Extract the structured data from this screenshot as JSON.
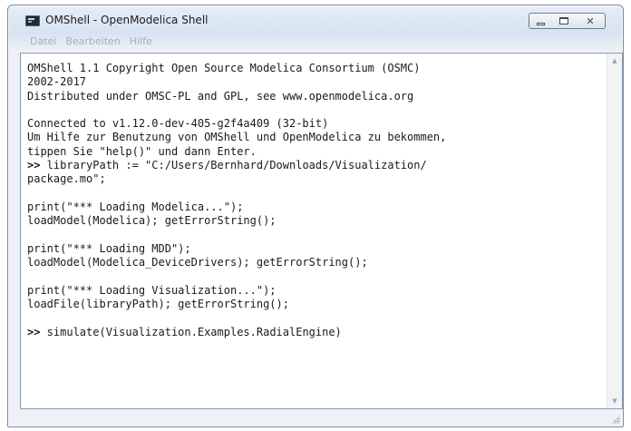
{
  "window": {
    "title": "OMShell - OpenModelica Shell",
    "controls": {
      "minimize_icon": "minimize-icon",
      "maximize_icon": "maximize-icon",
      "close_icon": "close-icon",
      "close_glyph": "✕"
    }
  },
  "menubar": {
    "items": [
      "Datei",
      "Bearbeiten",
      "Hilfe"
    ]
  },
  "console": {
    "lines": [
      {
        "prompt": "",
        "text": "OMShell 1.1 Copyright Open Source Modelica Consortium (OSMC)"
      },
      {
        "prompt": "",
        "text": "2002-2017"
      },
      {
        "prompt": "",
        "text": "Distributed under OMSC-PL and GPL, see www.openmodelica.org"
      },
      {
        "prompt": "",
        "text": ""
      },
      {
        "prompt": "",
        "text": "Connected to v1.12.0-dev-405-g2f4a409 (32-bit)"
      },
      {
        "prompt": "",
        "text": "Um Hilfe zur Benutzung von OMShell und OpenModelica zu bekommen,"
      },
      {
        "prompt": "",
        "text": "tippen Sie \"help()\" und dann Enter."
      },
      {
        "prompt": ">>",
        "text": " libraryPath := \"C:/Users/Bernhard/Downloads/Visualization/"
      },
      {
        "prompt": "",
        "text": "package.mo\";"
      },
      {
        "prompt": "",
        "text": ""
      },
      {
        "prompt": "",
        "text": "print(\"*** Loading Modelica...\");"
      },
      {
        "prompt": "",
        "text": "loadModel(Modelica); getErrorString();"
      },
      {
        "prompt": "",
        "text": ""
      },
      {
        "prompt": "",
        "text": "print(\"*** Loading MDD\");"
      },
      {
        "prompt": "",
        "text": "loadModel(Modelica_DeviceDrivers); getErrorString();"
      },
      {
        "prompt": "",
        "text": ""
      },
      {
        "prompt": "",
        "text": "print(\"*** Loading Visualization...\");"
      },
      {
        "prompt": "",
        "text": "loadFile(libraryPath); getErrorString();"
      },
      {
        "prompt": "",
        "text": ""
      },
      {
        "prompt": ">>",
        "text": " simulate(Visualization.Examples.RadialEngine)"
      }
    ]
  },
  "scrollbar": {
    "up_glyph": "▲",
    "down_glyph": "▼"
  },
  "colors": {
    "titlebar": "#d7e3f0",
    "border": "#7a8a9c",
    "text": "#1a1a1a",
    "menu_disabled": "#a7afb8"
  }
}
